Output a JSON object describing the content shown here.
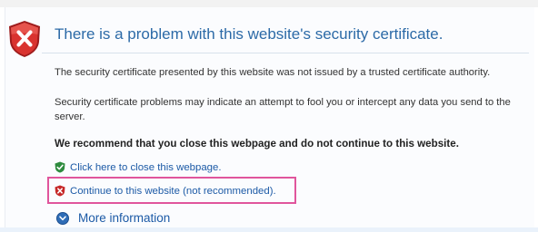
{
  "header": {
    "title": "There is a problem with this website's security certificate."
  },
  "body": {
    "para1": "The security certificate presented by this website was not issued by a trusted certificate authority.",
    "para2": "Security certificate problems may indicate an attempt to fool you or intercept any data you send to the server.",
    "recommendation": "We recommend that you close this webpage and do not continue to this website."
  },
  "links": {
    "close": "Click here to close this webpage.",
    "continue": "Continue to this website (not recommended).",
    "more_info": "More information"
  },
  "icons": {
    "header": "error-shield-icon",
    "close": "green-shield-check-icon",
    "continue": "red-shield-x-icon",
    "more_info": "expand-chevron-icon"
  },
  "colors": {
    "title": "#2c6aa7",
    "link": "#1c5aa6",
    "highlight": "#e0559c",
    "error": "#c62828",
    "ok": "#2e8b3e"
  }
}
